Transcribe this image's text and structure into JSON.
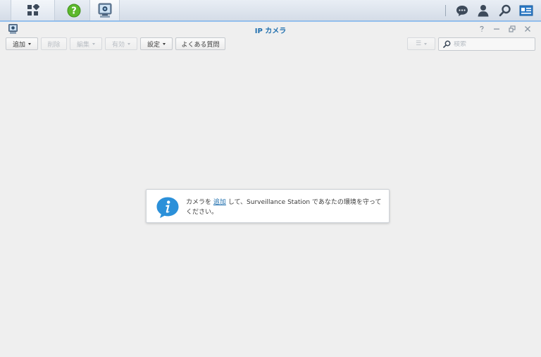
{
  "taskbar": {
    "apps": [
      {
        "name": "main-menu",
        "icon": "grid-apps-icon"
      },
      {
        "name": "help",
        "icon": "help-icon",
        "color": "#5cb82c"
      },
      {
        "name": "surveillance-station",
        "icon": "camera-app-icon"
      }
    ],
    "right_icons": [
      "chat-icon",
      "user-icon",
      "search-icon",
      "widget-icon"
    ]
  },
  "window": {
    "title": "IP カメラ",
    "controls": [
      "help-icon",
      "minimize-icon",
      "restore-icon",
      "close-icon"
    ]
  },
  "toolbar": {
    "add_label": "追加",
    "delete_label": "削除",
    "edit_label": "編集",
    "enable_label": "有効",
    "settings_label": "設定",
    "faq_label": "よくある質問",
    "view_label": "☰",
    "search_placeholder": "検索"
  },
  "info": {
    "text_before": "カメラを ",
    "link_text": "追加",
    "text_after": " して、Surveillance Station であなたの環境を守ってください。"
  },
  "colors": {
    "accent": "#1f6fae",
    "info_icon": "#2b90d9",
    "background": "#efefef"
  }
}
